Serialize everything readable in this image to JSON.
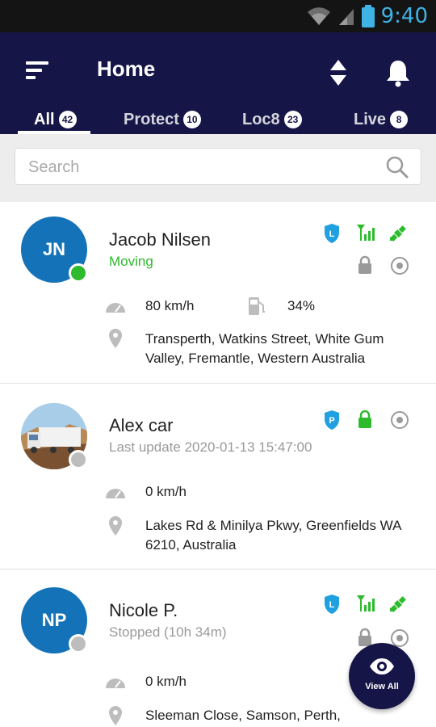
{
  "status_bar": {
    "time": "9:40"
  },
  "header": {
    "title": "Home"
  },
  "tabs": [
    {
      "label": "All",
      "count": "42"
    },
    {
      "label": "Protect",
      "count": "10"
    },
    {
      "label": "Loc8",
      "count": "23"
    },
    {
      "label": "Live",
      "count": "8"
    }
  ],
  "search": {
    "placeholder": "Search"
  },
  "cards": [
    {
      "initials": "JN",
      "name": "Jacob Nilsen",
      "status": "Moving",
      "speed": "80 km/h",
      "fuel": "34%",
      "address": "Transperth, Watkins Street, White Gum Valley, Fremantle, Western Australia",
      "badge_letter": "L"
    },
    {
      "name": "Alex car",
      "status": "Last update 2020-01-13 15:47:00",
      "speed": "0 km/h",
      "address": "Lakes Rd & Minilya Pkwy, Greenfields WA 6210, Australia",
      "badge_letter": "P"
    },
    {
      "initials": "NP",
      "name": "Nicole P.",
      "status": "Stopped (10h 34m)",
      "speed": "0 km/h",
      "address": "Sleeman Close, Samson, Perth,",
      "badge_letter": "L"
    }
  ],
  "fab": {
    "label": "View All"
  },
  "colors": {
    "header": "#151547",
    "accent_blue": "#1fa0e0",
    "green": "#2dbb2d",
    "avatar_blue": "#1473b8"
  },
  "icons": [
    "menu-icon",
    "sort-icon",
    "bell-icon",
    "search-icon",
    "speed-icon",
    "fuel-icon",
    "location-pin-icon",
    "lock-icon",
    "target-icon",
    "signal-icon",
    "satellite-icon",
    "eye-icon"
  ]
}
